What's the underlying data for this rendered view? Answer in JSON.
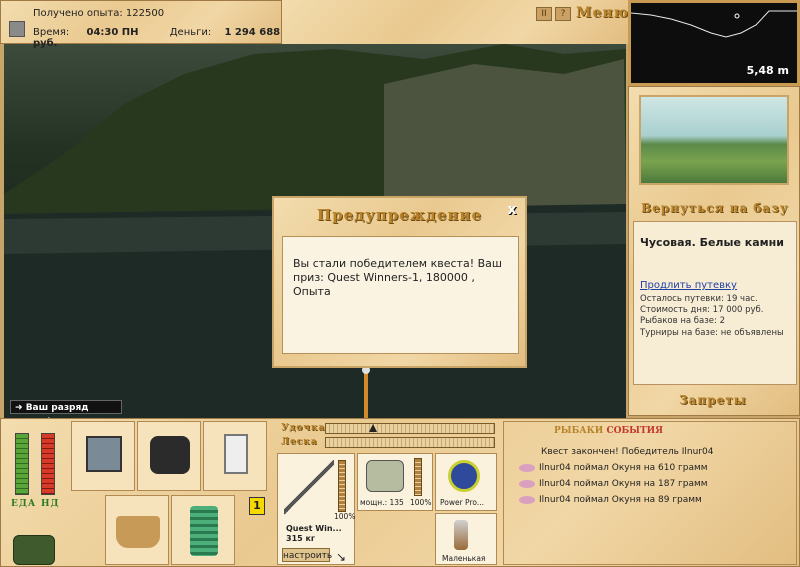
{
  "info": {
    "experience_label": "Получено опыта:",
    "experience_value": "122500",
    "time_label": "Время:",
    "time_value": "04:30 ПН",
    "money_label": "Деньги:",
    "money_value": "1 294 688 руб."
  },
  "top_menu": {
    "pause_label": "II",
    "help_label": "?",
    "menu_label": "Меню"
  },
  "depth": {
    "value": "5,48 m"
  },
  "base": {
    "return_label": "Вернуться на базу",
    "location_name": "Чусовая. Белые камни",
    "extend_link": "Продлить путевку",
    "remaining": "Осталось путевки: 19 час.",
    "day_cost": "Стоимость дня: 17 000 руб.",
    "fishers": "Рыбаков на базе: 2",
    "tournaments": "Турниры на базе: не объявлены",
    "bans_label": "Запреты"
  },
  "rank_notice": "Ваш разряд вырос!",
  "dialog": {
    "title": "Предупреждение",
    "close_label": "x",
    "message": "Вы стали победителем квеста! Ваш приз: Quest Winners-1, 180000 , Опыта"
  },
  "meters": {
    "food_label": "ЕДА",
    "energy_label": "НД",
    "level_badge": "1"
  },
  "tackle": {
    "rod_label": "Удочка",
    "line_label": "Леска",
    "rod_name": "Quest Win...",
    "rod_weight": "315 кг",
    "rod_pct": "100%",
    "reel_name": "мощн.: 135",
    "reel_pct": "100%",
    "line_name": "Power Pro...",
    "hook_name": "Маленькая",
    "setup_button": "настроить"
  },
  "events": {
    "tab_fishers": "РЫБАКИ",
    "tab_events": "СОБЫТИЯ",
    "items": [
      "Квест закончен! Победитель Ilnur04",
      "Ilnur04 поймал Окуня на 610 грамм",
      "Ilnur04 поймал Окуня на 187 грамм",
      "Ilnur04 поймал Окуня на 89 грамм"
    ]
  },
  "colors": {
    "accent_gold": "#b8832a",
    "event_red": "#c0392b",
    "wood_light": "#f3dcae"
  }
}
